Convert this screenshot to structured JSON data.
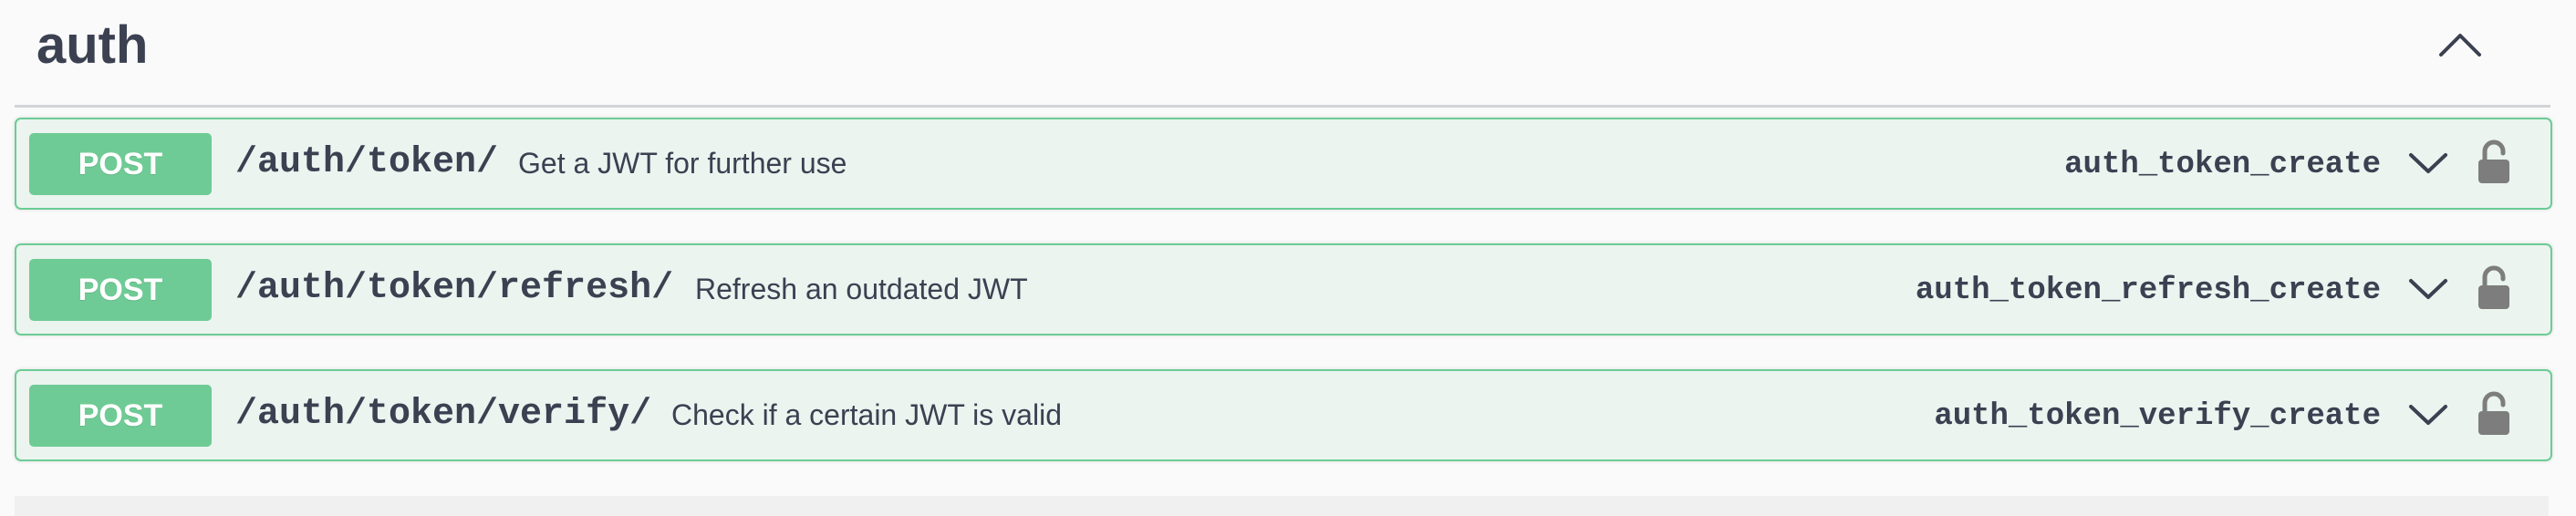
{
  "tag": {
    "title": "auth",
    "toggle_icon": "chevron-up-icon"
  },
  "operations": [
    {
      "method": "POST",
      "path": "/auth/token/",
      "summary": "Get a JWT for further use",
      "operation_id": "auth_token_create",
      "toggle_icon": "chevron-down-icon",
      "lock_icon": "unlocked-padlock-icon"
    },
    {
      "method": "POST",
      "path": "/auth/token/refresh/",
      "summary": "Refresh an outdated JWT",
      "operation_id": "auth_token_refresh_create",
      "toggle_icon": "chevron-down-icon",
      "lock_icon": "unlocked-padlock-icon"
    },
    {
      "method": "POST",
      "path": "/auth/token/verify/",
      "summary": "Check if a certain JWT is valid",
      "operation_id": "auth_token_verify_create",
      "toggle_icon": "chevron-down-icon",
      "lock_icon": "unlocked-padlock-icon"
    }
  ],
  "colors": {
    "post_method": "#6fcb95",
    "opblock_background": "#ebf4ef",
    "opblock_border": "#6ccc95",
    "text": "#3b4151",
    "icon": "#7d7d7d"
  }
}
